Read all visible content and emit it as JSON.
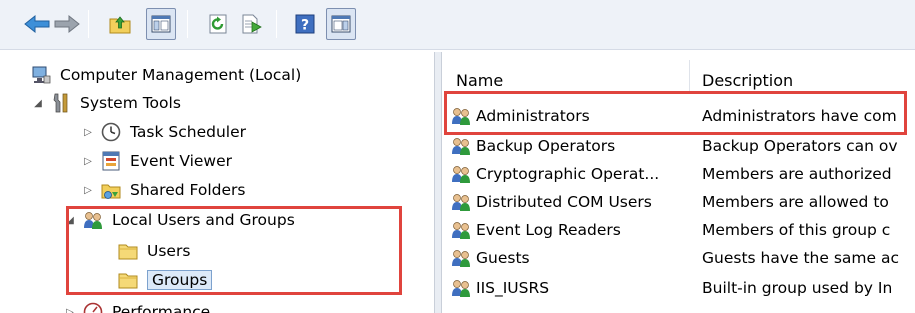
{
  "toolbar": {
    "buttons": [
      {
        "name": "back-button",
        "icon": "back-arrow-icon"
      },
      {
        "name": "forward-button",
        "icon": "forward-arrow-icon"
      },
      {
        "name": "up-folder-button",
        "icon": "folder-up-icon"
      },
      {
        "name": "show-hide-console-tree-button",
        "icon": "console-tree-icon"
      },
      {
        "name": "refresh-button",
        "icon": "refresh-icon"
      },
      {
        "name": "export-list-button",
        "icon": "export-list-icon"
      },
      {
        "name": "help-button",
        "icon": "help-icon"
      },
      {
        "name": "show-hide-action-pane-button",
        "icon": "action-pane-icon"
      }
    ]
  },
  "tree": {
    "root": "Computer Management (Local)",
    "system_tools": "System Tools",
    "task_scheduler": "Task Scheduler",
    "event_viewer": "Event Viewer",
    "shared_folders": "Shared Folders",
    "local_users_groups": "Local Users and Groups",
    "users": "Users",
    "groups": "Groups",
    "performance": "Performance"
  },
  "list": {
    "columns": [
      "Name",
      "Description"
    ],
    "rows": [
      {
        "name": "Administrators",
        "description": "Administrators have com"
      },
      {
        "name": "Backup Operators",
        "description": "Backup Operators can ov"
      },
      {
        "name": "Cryptographic Operat...",
        "description": "Members are authorized"
      },
      {
        "name": "Distributed COM Users",
        "description": "Members are allowed to"
      },
      {
        "name": "Event Log Readers",
        "description": "Members of this group c"
      },
      {
        "name": "Guests",
        "description": "Guests have the same ac"
      },
      {
        "name": "IIS_IUSRS",
        "description": "Built-in group used by In"
      }
    ]
  },
  "colors": {
    "highlight": "#e0443d",
    "selection": "#dce9f8",
    "toolbar_bg": "#eef2f8"
  }
}
